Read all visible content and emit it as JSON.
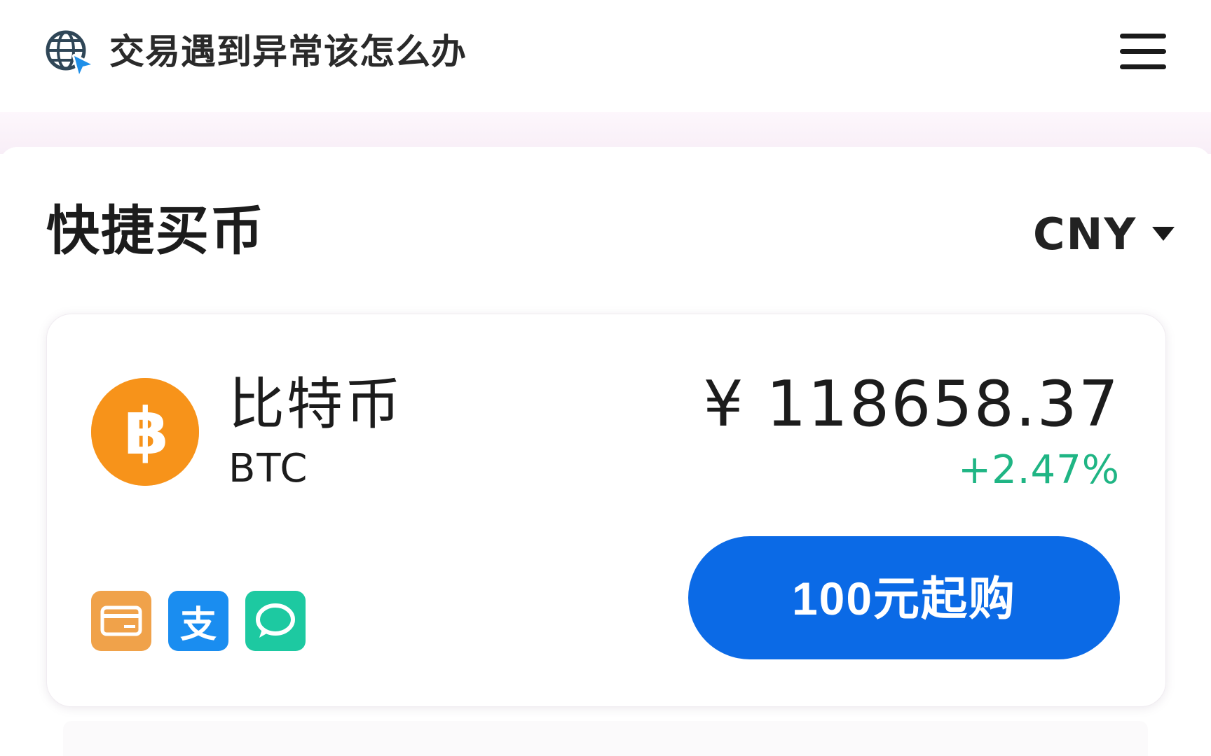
{
  "header": {
    "title": "交易遇到异常该怎么办",
    "logo_icon": "globe-cursor-icon",
    "menu_icon": "hamburger-menu-icon"
  },
  "quick_buy": {
    "title": "快捷买币",
    "currency": "CNY"
  },
  "coin": {
    "icon": "bitcoin-icon",
    "name": "比特币",
    "symbol": "BTC",
    "price": "¥ 118658.37",
    "change": "+2.47%",
    "buy_button_label": "100元起购"
  },
  "payment_methods": [
    {
      "icon": "bank-card-icon"
    },
    {
      "icon": "alipay-icon",
      "glyph": "支"
    },
    {
      "icon": "wechat-pay-icon"
    }
  ],
  "colors": {
    "accent_blue": "#0b6ae6",
    "bitcoin_orange": "#f7931a",
    "positive_green": "#1fb584",
    "bank_orange": "#f0a24a",
    "alipay_blue": "#1a8df0",
    "wechat_teal": "#1dc9a1"
  }
}
